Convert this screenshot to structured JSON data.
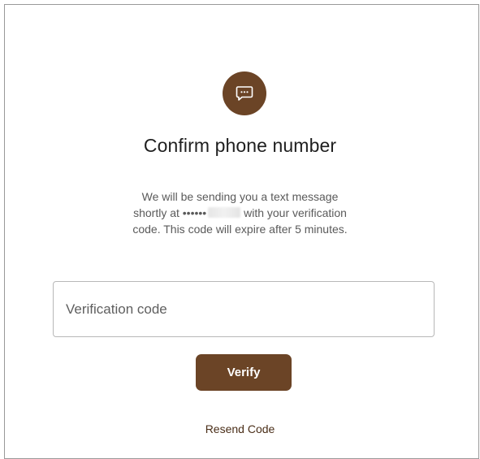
{
  "icon": {
    "name": "message-icon",
    "background": "#6b4426"
  },
  "title": "Confirm phone number",
  "message": {
    "line1": "We will be sending you a text message",
    "line2_prefix": "shortly at",
    "masked_phone": "••••••",
    "line2_suffix": "with your verification",
    "line3": "code. This code will expire after 5 minutes."
  },
  "form": {
    "code_placeholder": "Verification code",
    "code_value": "",
    "verify_label": "Verify"
  },
  "resend_label": "Resend Code",
  "colors": {
    "brand": "#6b4426",
    "text": "#1f1f1f",
    "muted": "#5a5a5a"
  }
}
